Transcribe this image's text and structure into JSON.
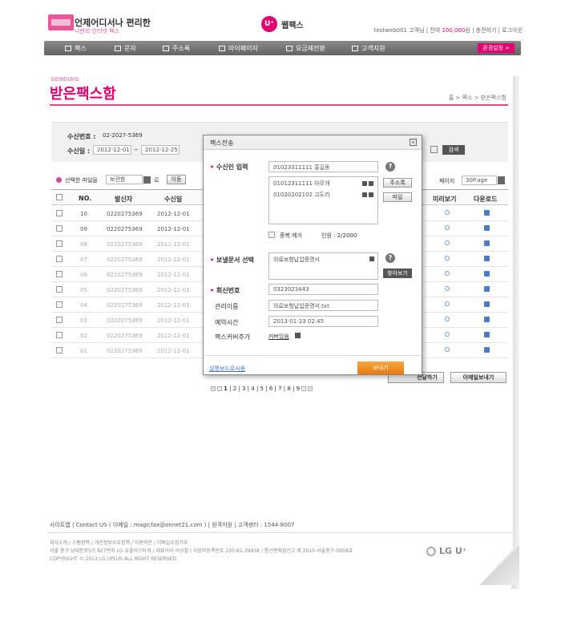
{
  "header": {
    "slogan_main": "언제어디서나 편리한",
    "slogan_sub": "나만의 인터넷 팩스",
    "brand_mark": "U⁺",
    "brand_name": "웹팩스",
    "user_bar_prefix": "testweb001 고객님 | 잔여",
    "user_points": "100,000",
    "user_bar_suffix": "원 | 충전하기 | 로그아웃"
  },
  "menu": {
    "items": [
      "팩스",
      "문자",
      "주소록",
      "마이페이지",
      "요금제전환",
      "고객지원"
    ],
    "env_button": "환경설정 >"
  },
  "page": {
    "section_tag": "SENDING",
    "title": "받은팩스함",
    "breadcrumb": "홈 > 팩스 > 받은팩스함"
  },
  "search": {
    "receive_no_label": "수신번호 :",
    "receive_no_value": "02-2027-5369",
    "date_label": "수신일 :",
    "date_from": "2012-12-01",
    "date_to": "2012-12-25",
    "search_button": "검색"
  },
  "list_controls": {
    "selected_prefix": "선택한 파일을",
    "action_select": "보관함",
    "move_button": "이동",
    "page_label": "페이지",
    "page_size": "30P.age"
  },
  "table": {
    "headers": [
      "NO.",
      "발신자",
      "수신일",
      "미리보기",
      "다운로드"
    ],
    "rows": [
      {
        "no": "10",
        "sender": "0220275369",
        "date": "2012-12-01"
      },
      {
        "no": "09",
        "sender": "0220275369",
        "date": "2012-12-01"
      },
      {
        "no": "08",
        "sender": "0220275369",
        "date": "2012-12-01"
      },
      {
        "no": "07",
        "sender": "0220275369",
        "date": "2012-12-01"
      },
      {
        "no": "06",
        "sender": "0220275369",
        "date": "2012-12-01"
      },
      {
        "no": "05",
        "sender": "0220275369",
        "date": "2012-12-01"
      },
      {
        "no": "04",
        "sender": "0220275369",
        "date": "2012-12-01"
      },
      {
        "no": "03",
        "sender": "0220275369",
        "date": "2012-12-01"
      },
      {
        "no": "02",
        "sender": "0220275369",
        "date": "2012-12-01"
      },
      {
        "no": "01",
        "sender": "0220275369",
        "date": "2012-12-01"
      }
    ]
  },
  "bottom_buttons": {
    "forward": "전달하기",
    "email_send": "이메일보내기"
  },
  "pagination": {
    "pages": [
      "1",
      "2",
      "3",
      "4",
      "5",
      "6",
      "7",
      "8",
      "9"
    ],
    "current": "1"
  },
  "modal": {
    "title": "팩스전송",
    "close": "x",
    "recipient_label": "수신인 입력",
    "recipient_input": "01023311111 홍길동",
    "address_book_button": "주소록",
    "file_button": "파일",
    "recipients": [
      "01012311111 아무개",
      "01020202102 고도리"
    ],
    "dedupe_label": "중복 제거",
    "count_text": "인원 : 2/2000",
    "doc_label": "보낼문서 선택",
    "doc_value": "의료보험납입증명서",
    "doc_browse_button": "찾아보기",
    "reply_label": "회신번호",
    "reply_value": "0323023443",
    "manage_label": "관리이름",
    "manage_value": "의료보험납입증명서.txt",
    "reserve_label": "예약시간",
    "reserve_value": "2013-01-23 02:45",
    "cover_label": "팩스커버추가",
    "cover_value": "커버있음",
    "help_link": "설명보드로사용",
    "send_button": "보내기"
  },
  "footer": {
    "links": "사이트맵  |  Contact US ( 이메일 : magicfax@onnet21.com )  |  원격지원  |  고객센터 : 1544-8007",
    "info_line1": "회사소개 / 스팸정책 / 개인정보보호정책 / 이용약관 / 이메일수집거부",
    "info_line2": "서울 중구 남대문로5가 827번지 LG 유플러스타워 / 대표이사 이상철 / 사업자등록번호 220-81-39938 / 통신판매업신고 제 2010-서울중구-0958호",
    "info_line3": "COPYRIGHT © 2013 LG UPLUS ALL RIGHT RESERVED",
    "logo_text": "LG U⁺"
  }
}
